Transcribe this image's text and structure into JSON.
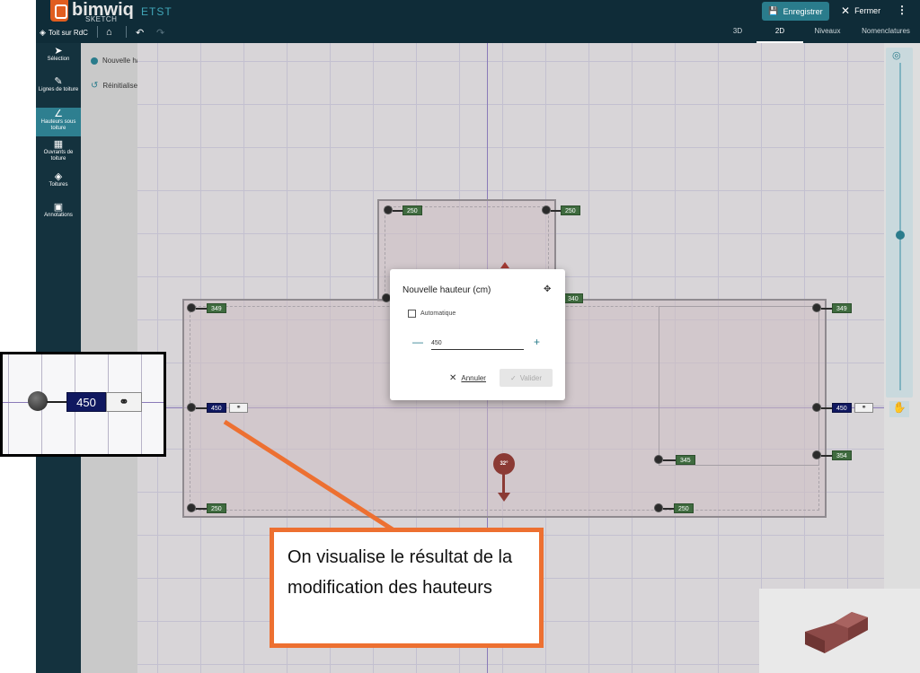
{
  "header": {
    "logo_text": "bimwiq",
    "logo_sub": "SKETCH",
    "project_name": "ETST",
    "save_label": "Enregistrer",
    "close_label": "Fermer",
    "more_icon": "kebab-icon"
  },
  "toolbar": {
    "floor_label": "Toit sur RdC",
    "tabs": [
      {
        "label": "3D",
        "active": false
      },
      {
        "label": "2D",
        "active": true
      },
      {
        "label": "Niveaux",
        "active": false
      },
      {
        "label": "Nomenclatures",
        "active": false
      }
    ]
  },
  "sidebar": {
    "items": [
      {
        "label": "Sélection",
        "icon": "cursor-icon",
        "active": false
      },
      {
        "label": "Lignes de toiture",
        "icon": "pencil-icon",
        "active": false
      },
      {
        "label": "Hauteurs sous toiture",
        "icon": "angle-icon",
        "active": true
      },
      {
        "label": "Ouvrants de toiture",
        "icon": "window-icon",
        "active": false
      },
      {
        "label": "Toitures",
        "icon": "layers-icon",
        "active": false
      },
      {
        "label": "Annotations",
        "icon": "comment-icon",
        "active": false
      }
    ]
  },
  "panel": {
    "new_height": "Nouvelle hauteur",
    "reset": "Réinitialiser"
  },
  "heights": {
    "top_left": "250",
    "top_right": "250",
    "mid_left": "349",
    "mid_center": "340",
    "mid_right": "349",
    "left_selected": "450",
    "right_selected": "450",
    "inner_left": "345",
    "inner_right": "354",
    "bottom_left": "250",
    "bottom_right": "250"
  },
  "slope": {
    "value": "32°"
  },
  "dialog": {
    "title": "Nouvelle hauteur (cm)",
    "automatic_label": "Automatique",
    "automatic_checked": false,
    "value": "450",
    "cancel_label": "Annuler",
    "validate_label": "Valider"
  },
  "inset": {
    "value": "450"
  },
  "callout": {
    "text": "On visualise le résultat de la modification des hauteurs",
    "color": "#ed7031"
  },
  "colors": {
    "topbar": "#0f2c38",
    "accent": "#2a7c8c",
    "selected_label": "#101860",
    "height_label": "#3f6b3f"
  }
}
